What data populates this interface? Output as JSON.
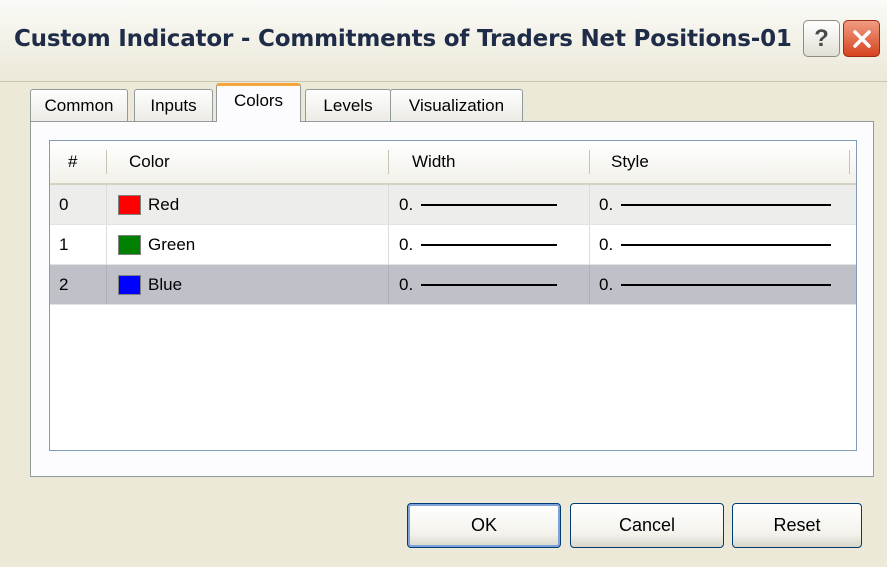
{
  "window": {
    "title": "Custom Indicator - Commitments of Traders Net Positions-01",
    "help_label": "?",
    "close_icon": "close-icon"
  },
  "tabs": [
    {
      "label": "Common",
      "active": false
    },
    {
      "label": "Inputs",
      "active": false
    },
    {
      "label": "Colors",
      "active": true
    },
    {
      "label": "Levels",
      "active": false
    },
    {
      "label": "Visualization",
      "active": false
    }
  ],
  "table": {
    "columns": [
      "#",
      "Color",
      "Width",
      "Style"
    ],
    "rows": [
      {
        "index": "0",
        "color_name": "Red",
        "color_hex": "#FF0000",
        "width": "0.",
        "style": "0.",
        "selected": false
      },
      {
        "index": "1",
        "color_name": "Green",
        "color_hex": "#008000",
        "width": "0.",
        "style": "0.",
        "selected": false
      },
      {
        "index": "2",
        "color_name": "Blue",
        "color_hex": "#0000FF",
        "width": "0.",
        "style": "0.",
        "selected": true
      }
    ]
  },
  "buttons": {
    "ok": "OK",
    "cancel": "Cancel",
    "reset": "Reset"
  },
  "colors": {
    "dialog_bg": "#ECE9D8",
    "active_tab_accent": "#F2A63B",
    "selected_row": "#BFC0C8",
    "close_button": "#D6431F"
  }
}
